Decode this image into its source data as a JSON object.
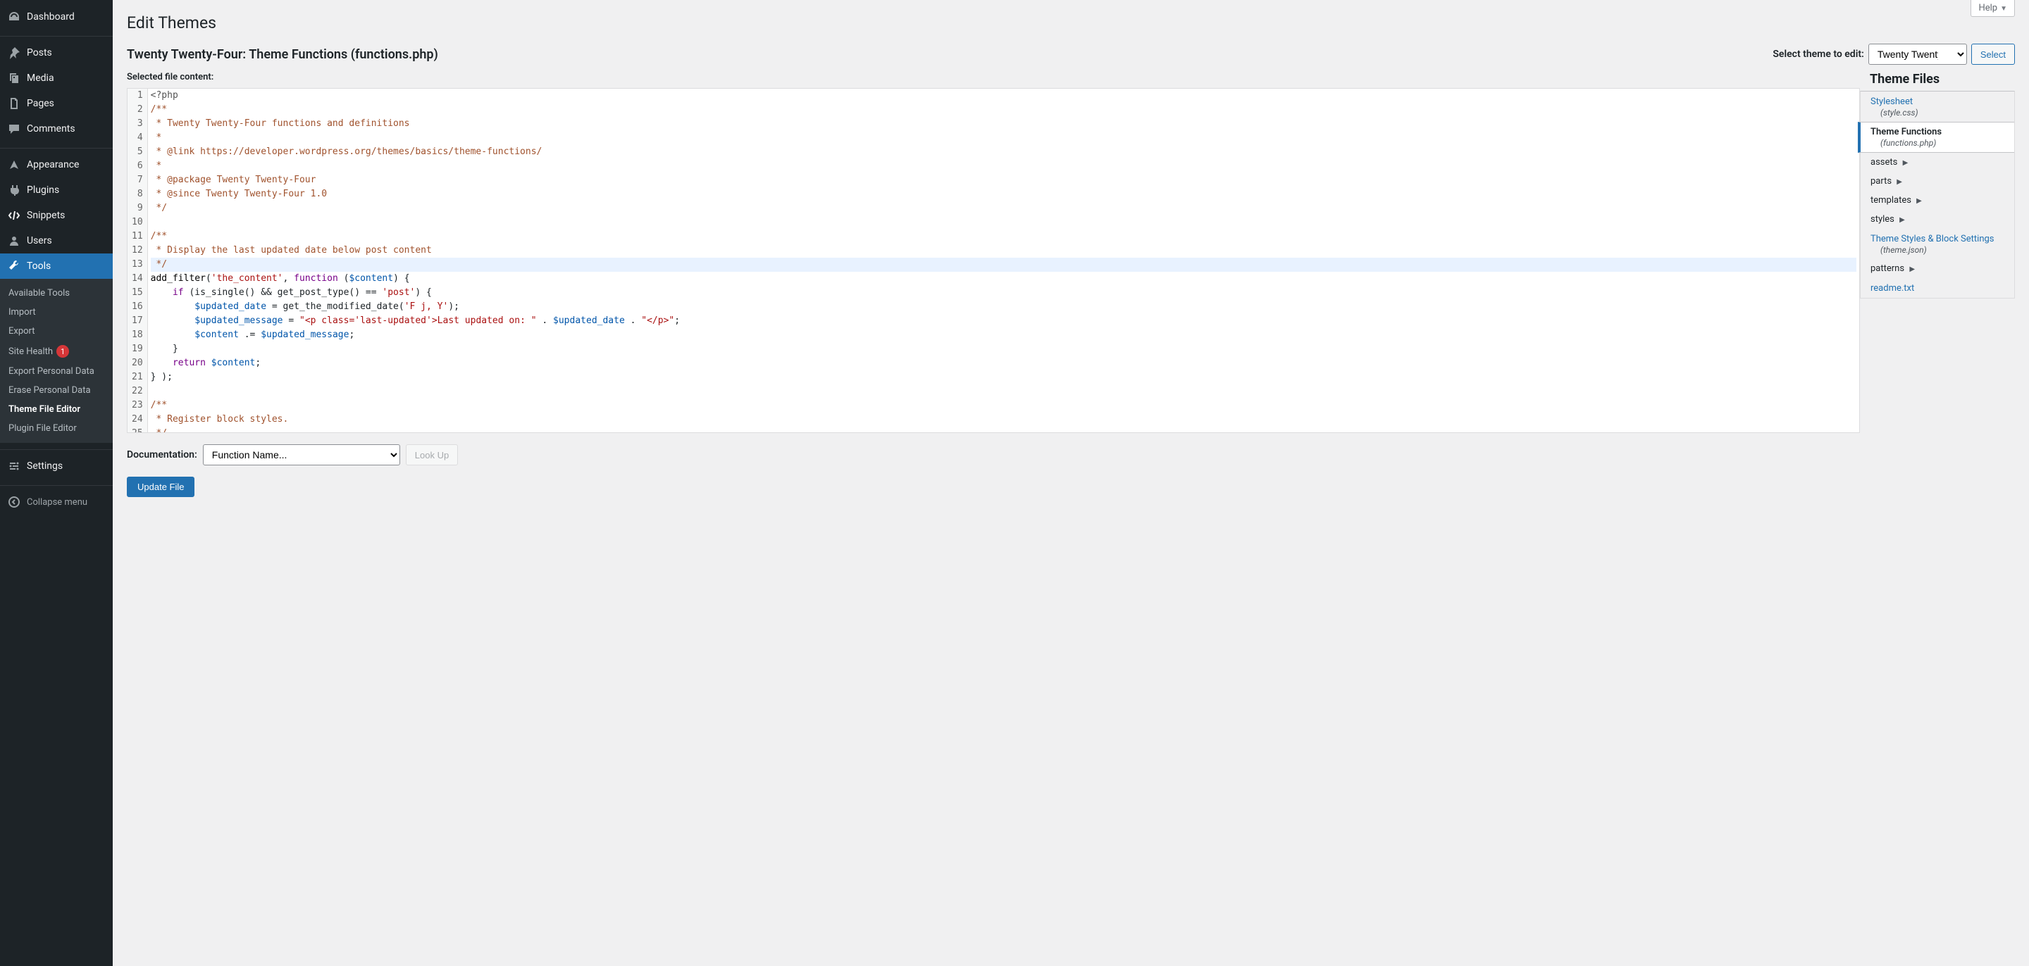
{
  "sidebar": {
    "items": [
      {
        "label": "Dashboard",
        "icon": "dashboard"
      },
      {
        "label": "Posts",
        "icon": "pin"
      },
      {
        "label": "Media",
        "icon": "media"
      },
      {
        "label": "Pages",
        "icon": "pages"
      },
      {
        "label": "Comments",
        "icon": "comments"
      },
      {
        "label": "Appearance",
        "icon": "appearance"
      },
      {
        "label": "Plugins",
        "icon": "plugins"
      },
      {
        "label": "Snippets",
        "icon": "snippets"
      },
      {
        "label": "Users",
        "icon": "users"
      },
      {
        "label": "Tools",
        "icon": "tools",
        "active": true
      },
      {
        "label": "Settings",
        "icon": "settings"
      }
    ],
    "submenu": {
      "items": [
        {
          "label": "Available Tools"
        },
        {
          "label": "Import"
        },
        {
          "label": "Export"
        },
        {
          "label": "Site Health",
          "badge": "1"
        },
        {
          "label": "Export Personal Data"
        },
        {
          "label": "Erase Personal Data"
        },
        {
          "label": "Theme File Editor",
          "current": true
        },
        {
          "label": "Plugin File Editor"
        }
      ]
    },
    "collapse": "Collapse menu"
  },
  "help_label": "Help",
  "page_title": "Edit Themes",
  "file_heading": "Twenty Twenty-Four: Theme Functions (functions.php)",
  "theme_select": {
    "label": "Select theme to edit:",
    "value": "Twenty Twenty-Four",
    "button": "Select"
  },
  "content_label": "Selected file content:",
  "code": {
    "lines": [
      [
        {
          "t": "<?php",
          "c": "meta"
        }
      ],
      [
        {
          "t": "/**",
          "c": "comment"
        }
      ],
      [
        {
          "t": " * Twenty Twenty-Four functions and definitions",
          "c": "comment"
        }
      ],
      [
        {
          "t": " *",
          "c": "comment"
        }
      ],
      [
        {
          "t": " * @link https://developer.wordpress.org/themes/basics/theme-functions/",
          "c": "comment"
        }
      ],
      [
        {
          "t": " *",
          "c": "comment"
        }
      ],
      [
        {
          "t": " * @package Twenty Twenty-Four",
          "c": "comment"
        }
      ],
      [
        {
          "t": " * @since Twenty Twenty-Four 1.0",
          "c": "comment"
        }
      ],
      [
        {
          "t": " */",
          "c": "comment"
        }
      ],
      [],
      [
        {
          "t": "/**",
          "c": "comment"
        }
      ],
      [
        {
          "t": " * Display the last updated date below post content",
          "c": "comment"
        }
      ],
      [
        {
          "t": " */",
          "c": "comment"
        }
      ],
      [
        {
          "t": "add_filter",
          "c": "variable"
        },
        {
          "t": "("
        },
        {
          "t": "'the_content'",
          "c": "string"
        },
        {
          "t": ", "
        },
        {
          "t": "function",
          "c": "keyword"
        },
        {
          "t": " ("
        },
        {
          "t": "$content",
          "c": "variable-2"
        },
        {
          "t": ") {"
        }
      ],
      [
        {
          "t": "    "
        },
        {
          "t": "if",
          "c": "keyword"
        },
        {
          "t": " (is_single() && get_post_type() == "
        },
        {
          "t": "'post'",
          "c": "string"
        },
        {
          "t": ") {"
        }
      ],
      [
        {
          "t": "        "
        },
        {
          "t": "$updated_date",
          "c": "variable-2"
        },
        {
          "t": " = get_the_modified_date("
        },
        {
          "t": "'F j, Y'",
          "c": "string"
        },
        {
          "t": ");"
        }
      ],
      [
        {
          "t": "        "
        },
        {
          "t": "$updated_message",
          "c": "variable-2"
        },
        {
          "t": " = "
        },
        {
          "t": "\"<p class='last-updated'>Last updated on: \"",
          "c": "string"
        },
        {
          "t": " . "
        },
        {
          "t": "$updated_date",
          "c": "variable-2"
        },
        {
          "t": " . "
        },
        {
          "t": "\"</p>\"",
          "c": "string"
        },
        {
          "t": ";"
        }
      ],
      [
        {
          "t": "        "
        },
        {
          "t": "$content",
          "c": "variable-2"
        },
        {
          "t": " .= "
        },
        {
          "t": "$updated_message",
          "c": "variable-2"
        },
        {
          "t": ";"
        }
      ],
      [
        {
          "t": "    }"
        }
      ],
      [
        {
          "t": "    "
        },
        {
          "t": "return",
          "c": "keyword"
        },
        {
          "t": " "
        },
        {
          "t": "$content",
          "c": "variable-2"
        },
        {
          "t": ";"
        }
      ],
      [
        {
          "t": "} );"
        }
      ],
      [],
      [
        {
          "t": "/**",
          "c": "comment"
        }
      ],
      [
        {
          "t": " * Register block styles.",
          "c": "comment"
        }
      ],
      [
        {
          "t": " */",
          "c": "comment"
        }
      ]
    ],
    "active_line": 13
  },
  "files": {
    "heading": "Theme Files",
    "items": [
      {
        "type": "file",
        "label": "Stylesheet",
        "paren": "(style.css)"
      },
      {
        "type": "file",
        "label": "Theme Functions",
        "paren": "(functions.php)",
        "current": true
      },
      {
        "type": "folder",
        "label": "assets"
      },
      {
        "type": "folder",
        "label": "parts"
      },
      {
        "type": "folder",
        "label": "templates"
      },
      {
        "type": "folder",
        "label": "styles"
      },
      {
        "type": "file",
        "label": "Theme Styles & Block Settings",
        "paren": "(theme.json)"
      },
      {
        "type": "folder",
        "label": "patterns"
      },
      {
        "type": "file",
        "label": "readme.txt"
      }
    ]
  },
  "documentation": {
    "label": "Documentation:",
    "placeholder": "Function Name...",
    "lookup": "Look Up"
  },
  "submit": "Update File"
}
